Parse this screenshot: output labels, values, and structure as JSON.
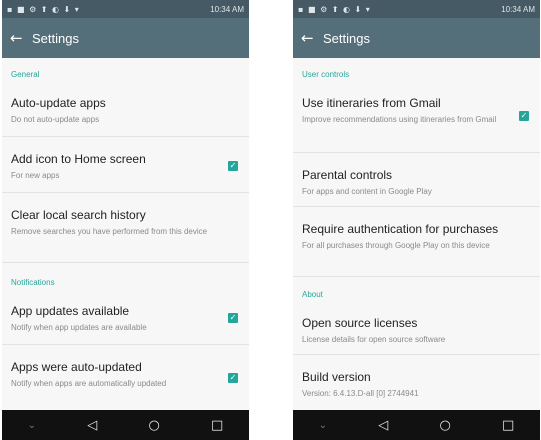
{
  "status_bar": {
    "left": {
      "icons": "▪ ■ ⚙ ⬆ ◐ ⬇ ▾",
      "time": "10:34 AM"
    },
    "right": {
      "icons": "▪ ■ ⚙ ⬆ ◐ ⬇ ▾",
      "time": "10:34 AM"
    }
  },
  "toolbar": {
    "back_glyph": "←",
    "title": "Settings"
  },
  "left_screen": {
    "sections": {
      "general": "General",
      "notifications": "Notifications"
    },
    "items": {
      "auto_update": {
        "title": "Auto-update apps",
        "subtitle": "Do not auto-update apps"
      },
      "add_icon": {
        "title": "Add icon to Home screen",
        "subtitle": "For new apps",
        "checked": true
      },
      "clear_history": {
        "title": "Clear local search history",
        "subtitle": "Remove searches you have performed from this device"
      },
      "app_updates": {
        "title": "App updates available",
        "subtitle": "Notify when app updates are available",
        "checked": true
      },
      "auto_updated": {
        "title": "Apps were auto-updated",
        "subtitle": "Notify when apps are automatically updated",
        "checked": true
      }
    }
  },
  "right_screen": {
    "sections": {
      "user_controls": "User controls",
      "about": "About"
    },
    "items": {
      "itineraries": {
        "title": "Use itineraries from Gmail",
        "subtitle": "Improve recommendations using itineraries from Gmail",
        "checked": true
      },
      "parental": {
        "title": "Parental controls",
        "subtitle": "For apps and content in Google Play"
      },
      "require_auth": {
        "title": "Require authentication for purchases",
        "subtitle": "For all purchases through Google Play on this device"
      },
      "open_source": {
        "title": "Open source licenses",
        "subtitle": "License details for open source software"
      },
      "build": {
        "title": "Build version",
        "subtitle": "Version: 6.4.13.D-all [0] 2744941"
      }
    }
  },
  "nav_bar": {
    "down": "⌄",
    "back": "◁",
    "home": "○",
    "recents": "□"
  },
  "colors": {
    "toolbar": "#546e7a",
    "status_bar": "#455a64",
    "accent": "#26a69a",
    "nav_bar": "#111111"
  }
}
